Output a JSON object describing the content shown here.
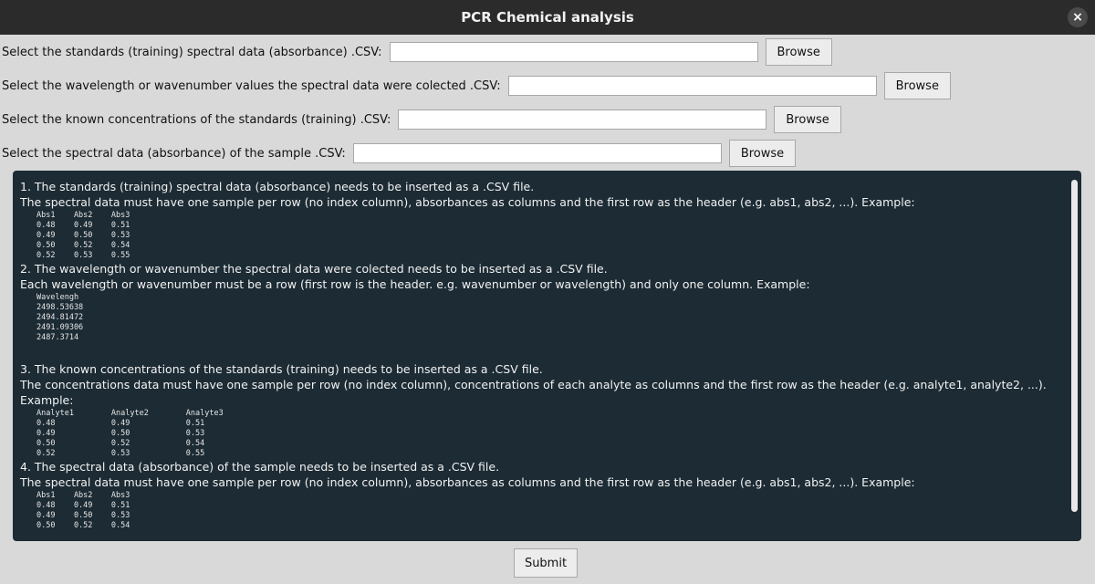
{
  "window": {
    "title": "PCR Chemical analysis",
    "close_icon": "×"
  },
  "form": {
    "row1": {
      "label": "Select the standards (training) spectral data (absorbance) .CSV:",
      "value": "",
      "button": "Browse"
    },
    "row2": {
      "label": "Select the wavelength or wavenumber values the spectral data were colected .CSV:",
      "value": "",
      "button": "Browse"
    },
    "row3": {
      "label": "Select the known concentrations of the standards (training) .CSV:",
      "value": "",
      "button": "Browse"
    },
    "row4": {
      "label": "Select the spectral data (absorbance) of the sample .CSV:",
      "value": "",
      "button": "Browse"
    }
  },
  "instructions": {
    "s1": {
      "heading": "1. The standards (training) spectral data (absorbance) needs to be inserted as a .CSV file.",
      "desc": "The spectral data must have one sample per row (no index column), absorbances as columns and the first row as the header (e.g. abs1, abs2, ...). Example:",
      "sample": "Abs1    Abs2    Abs3\n0.48    0.49    0.51\n0.49    0.50    0.53\n0.50    0.52    0.54\n0.52    0.53    0.55"
    },
    "s2": {
      "heading": "2. The wavelength or wavenumber the spectral data were colected needs to be inserted as a .CSV file.",
      "desc": "Each wavelength or wavenumber must be a row (first row is the header. e.g. wavenumber or wavelength) and only one column. Example:",
      "sample": "Wavelengh\n2498.53638\n2494.81472\n2491.09306\n2487.3714"
    },
    "s3": {
      "heading": "3. The known concentrations of the standards (training) needs to be inserted as a .CSV file.",
      "desc": "The concentrations data must have one sample per row (no index column), concentrations of each analyte as columns and the first row as the header (e.g. analyte1, analyte2, ...).",
      "desc2": "Example:",
      "sample": "Analyte1        Analyte2        Analyte3\n0.48            0.49            0.51\n0.49            0.50            0.53\n0.50            0.52            0.54\n0.52            0.53            0.55"
    },
    "s4": {
      "heading": "4. The spectral data (absorbance) of the sample needs to be inserted as a .CSV file.",
      "desc": "The spectral data must have one sample per row (no index column), absorbances as columns and the first row as the header (e.g. abs1, abs2, ...). Example:",
      "sample": "Abs1    Abs2    Abs3\n0.48    0.49    0.51\n0.49    0.50    0.53\n0.50    0.52    0.54"
    }
  },
  "submit_label": "Submit"
}
